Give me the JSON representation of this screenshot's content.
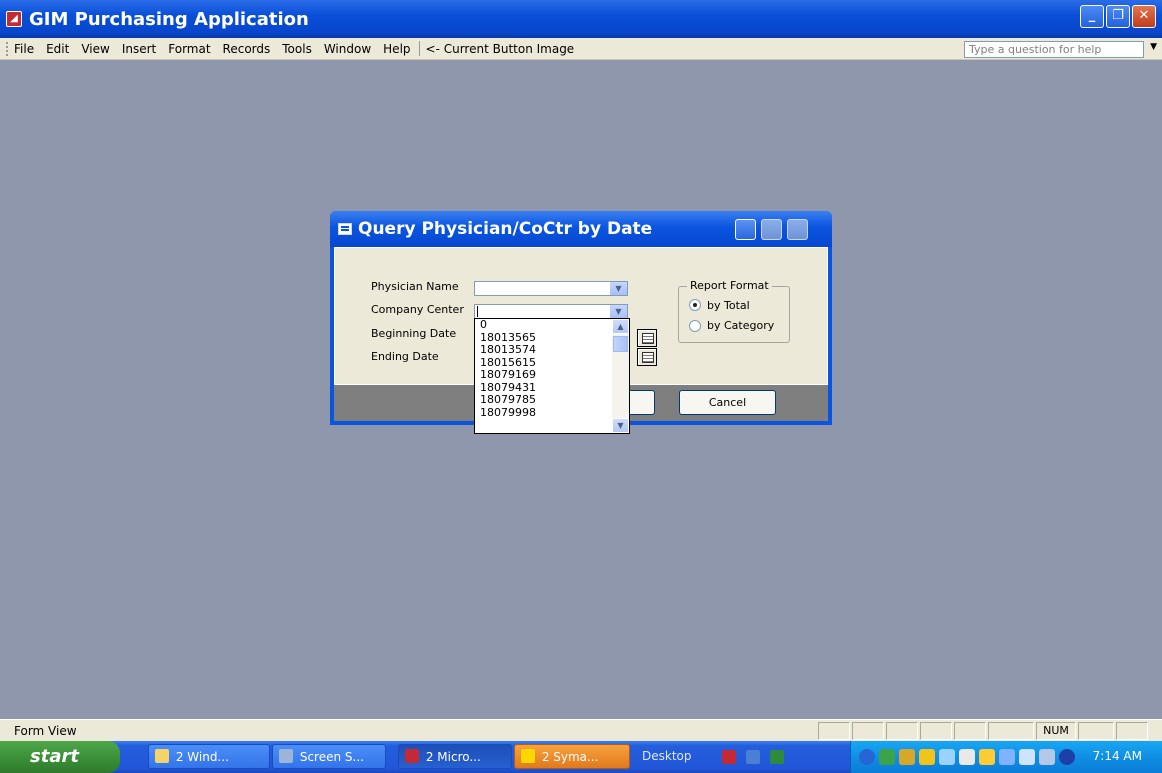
{
  "app": {
    "title": "GIM Purchasing Application"
  },
  "menu": {
    "items": [
      "File",
      "Edit",
      "View",
      "Insert",
      "Format",
      "Records",
      "Tools",
      "Window",
      "Help"
    ],
    "current_button_image": "<- Current Button Image",
    "help_placeholder": "Type a question for help"
  },
  "dialog": {
    "title": "Query Physician/CoCtr  by Date",
    "labels": {
      "physician": "Physician Name",
      "company": "Company Center",
      "beginning": "Beginning Date",
      "ending": "Ending Date"
    },
    "report_format": {
      "legend": "Report Format",
      "options": [
        {
          "label": "by Total",
          "checked": true
        },
        {
          "label": "by Category",
          "checked": false
        }
      ]
    },
    "cancel_label": "Cancel"
  },
  "dropdown": {
    "items": [
      "0",
      "18013565",
      "18013574",
      "18015615",
      "18079169",
      "18079431",
      "18079785",
      "18079998"
    ]
  },
  "status": {
    "text": "Form View",
    "num": "NUM"
  },
  "taskbar": {
    "start": "start",
    "tasks": [
      "2 Wind...",
      "Screen S...",
      "2 Micro...",
      "2 Syma..."
    ],
    "desktop": "Desktop",
    "clock": "7:14 AM"
  }
}
